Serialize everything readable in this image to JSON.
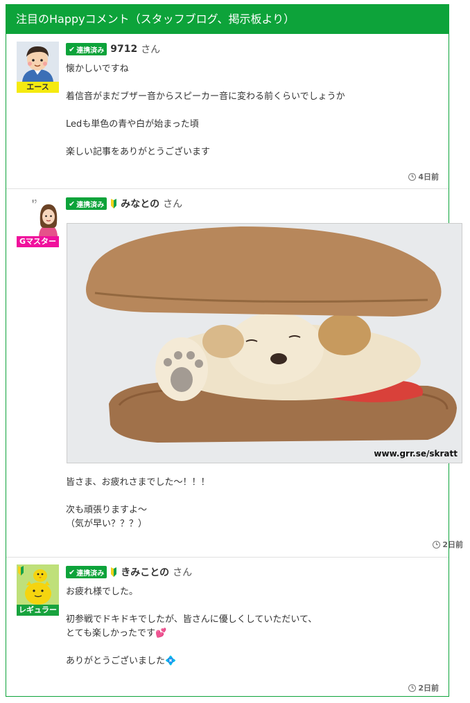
{
  "header": {
    "title": "注目のHappyコメント（スタッフブログ、掲示板より）"
  },
  "linked_badge_label": "連携済み",
  "san": "さん",
  "comments": [
    {
      "rank": "エース",
      "username": "9712",
      "beginner": false,
      "lines": [
        "懐かしいですね",
        "",
        "着信音がまだブザー音からスピーカー音に変わる前くらいでしょうか",
        "",
        "Ledも単色の青や白が始まった頃",
        "",
        "楽しい記事をありがとうございます"
      ],
      "time": "4日前"
    },
    {
      "rank": "Gマスター",
      "username": "みなとの",
      "beginner": true,
      "photo_watermark": "www.grr.se/skratt",
      "lines": [
        "皆さま、お疲れさまでした～！！！",
        "",
        "次も頑張りますよ～",
        "（気が早い？？？）"
      ],
      "time": "2日前"
    },
    {
      "rank": "レギュラー",
      "username": "きみことの",
      "beginner": true,
      "lines": [
        "お疲れ様でした。",
        "",
        "初参戦でドキドキでしたが、皆さんに優しくしていただいて、",
        "とても楽しかったです💕",
        "",
        "ありがとうございました💠"
      ],
      "time": "2日前"
    }
  ],
  "colors": {
    "accent": "#0da33a",
    "ace": "#f5ea10",
    "gmaster": "#f0109c",
    "regular": "#18a33e"
  }
}
